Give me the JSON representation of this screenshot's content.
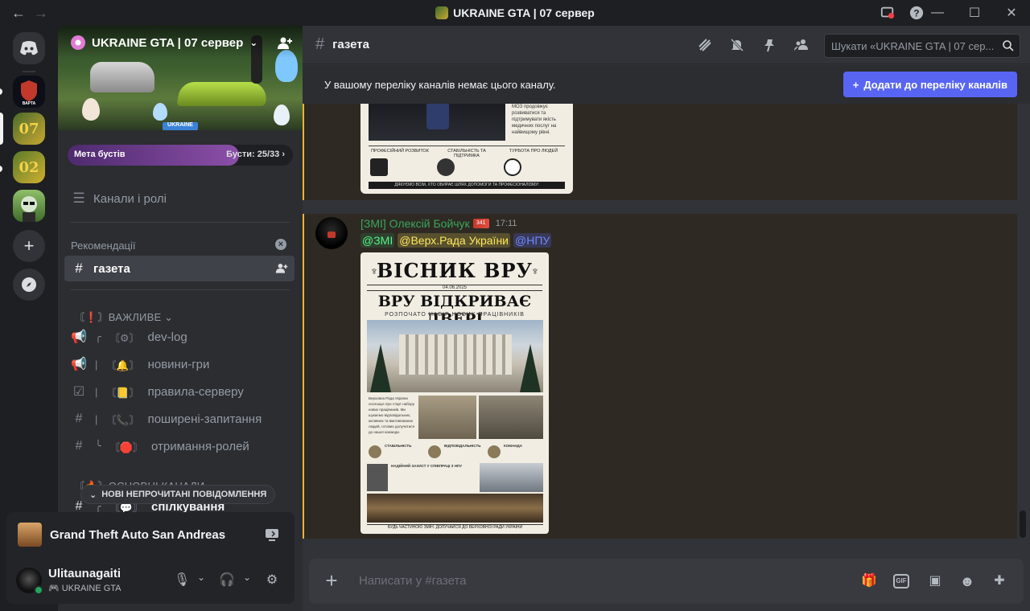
{
  "window": {
    "title": "UKRAINE GTA | 07 сервер"
  },
  "rail": {
    "servers": [
      {
        "name": "ВАРТА"
      },
      {
        "name": "07"
      },
      {
        "name": "02"
      },
      {
        "name": "avatar-server"
      }
    ]
  },
  "server": {
    "name": "UKRAINE GTA | 07 сервер",
    "boost_label": "Мета бустів",
    "boost_count": "Бусти: 25/33",
    "boost_progress": 0.76,
    "channels_roles": "Канали і ролі",
    "recommend_label": "Рекомендації",
    "recommended_channel": "газета",
    "banner_sign": "UKRAINE"
  },
  "categories": {
    "important": "ВАЖЛИВЕ",
    "main": "ОСНОВНІ КАНАЛИ"
  },
  "channels": [
    {
      "name": "dev-log",
      "icon": "megaphone-icon",
      "prefix": "╭",
      "emoji": "〘⚙〙"
    },
    {
      "name": "новини-гри",
      "icon": "megaphone-icon",
      "prefix": "|",
      "emoji": "〘🔔〙"
    },
    {
      "name": "правила-серверу",
      "icon": "rules-icon",
      "prefix": "|",
      "emoji": "〘📒〙"
    },
    {
      "name": "поширені-запитання",
      "icon": "hash-icon",
      "prefix": "|",
      "emoji": "〘📞〙"
    },
    {
      "name": "отримання-ролей",
      "icon": "hash-icon",
      "prefix": "╰",
      "emoji": "〘🛑〙"
    },
    {
      "name": "спілкування",
      "icon": "hash-icon",
      "prefix": "╭",
      "emoji": "〘💬〙"
    }
  ],
  "unread_pill": "НОВІ НЕПРОЧИТАНІ ПОВІДОМЛЕННЯ",
  "activity": {
    "game": "Grand Theft Auto San Andreas"
  },
  "user": {
    "name": "Ulitaunagaiti",
    "status": "UKRAINE GTA"
  },
  "header": {
    "channel": "газета",
    "search_placeholder": "Шукати «UKRAINE GTA | 07 сер..."
  },
  "notice": {
    "text": "У вашому переліку каналів немає цього каналу.",
    "button": "Додати до переліку каналів"
  },
  "message": {
    "author": "[ЗМІ] Олексій Бойчук",
    "time": "17:11",
    "mentions": [
      "@ЗМІ",
      "@Верх.Рада України",
      "@НПУ"
    ]
  },
  "newspaper1": {
    "side_text": "МОЗ продовжує розвиватися та підтримувати якість медичних послуг на найвищому рівні.",
    "c1": "ПРОФЕСІЙНИЙ РОЗВИТОК",
    "c2": "СТАБІЛЬНІСТЬ ТА ПІДТРИМКА",
    "c3": "ТУРБОТА ПРО ЛЮДЕЙ",
    "footer": "ДЯКУЄМО ВСІМ, ХТО ОБИРАЄ ШЛЯХ ДОПОМОГИ ТА ПРОФЕСІОНАЛІЗМУ!"
  },
  "newspaper2": {
    "masthead": "ВІСНИК ВРУ",
    "date": "04.06.2025",
    "headline": "ВРУ ВІДКРИВАЄ ДВЕРІ",
    "subhead": "РОЗПОЧАТО НАБІР НОВИХ ПРАЦІВНИКІВ",
    "lead": "Верховна Рада України оголошує про старт набору нових працівників. Ми шукаємо відповідальних, активних та вмотивованих людей, готових долучитися до нашої команди.",
    "col1": "СТАБІЛЬНІСТЬ",
    "col2": "ВІДПОВІДАЛЬНІСТЬ",
    "col3": "КОМАНДА",
    "defense": "НАДІЙНИЙ ЗАХИСТ У СПІВПРАЦІ З НПУ",
    "footer": "БУДЬ ЧАСТИНОЮ ЗМІН. ДОЛУЧАЙСЯ ДО ВЕРХОВНОЇ РАДИ УКРАЇНИ"
  },
  "composer": {
    "placeholder": "Написати у #газета"
  },
  "colors": {
    "accent": "#5865f2",
    "highlight": "#f0b232",
    "online": "#23a55a",
    "author": "#3ba55c"
  }
}
